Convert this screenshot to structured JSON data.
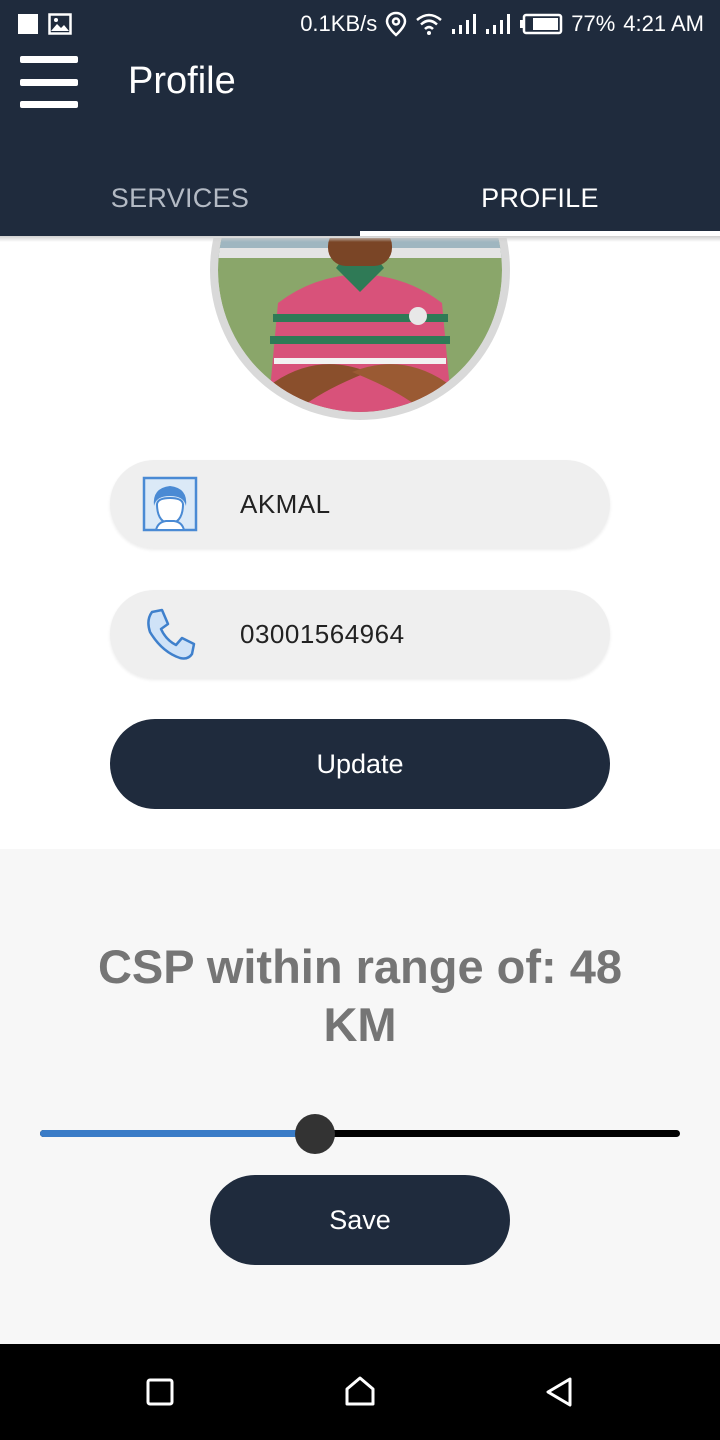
{
  "status_bar": {
    "network_speed": "0.1KB/s",
    "battery": "77%",
    "time": "4:21 AM"
  },
  "app_bar": {
    "title": "Profile",
    "tabs": [
      {
        "label": "SERVICES",
        "active": false
      },
      {
        "label": "PROFILE",
        "active": true
      }
    ]
  },
  "profile": {
    "name": "AKMAL",
    "phone": "03001564964",
    "update_label": "Update"
  },
  "range": {
    "text": "CSP within range of: 48 KM",
    "slider_fraction": 0.43,
    "save_label": "Save"
  },
  "colors": {
    "primary": "#1f2b3d",
    "slider_fill": "#3a7cc7",
    "field_bg": "#efefef"
  }
}
